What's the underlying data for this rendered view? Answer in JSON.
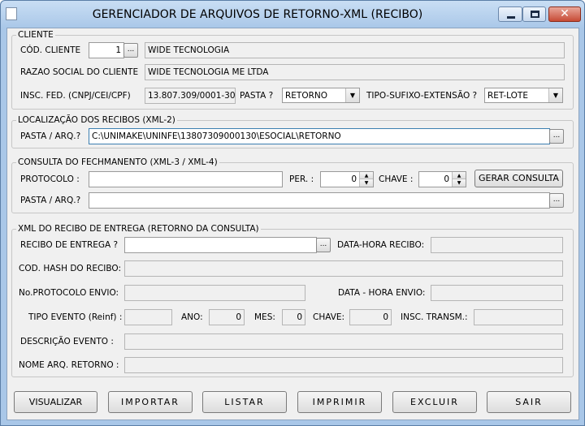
{
  "window": {
    "title": "GERENCIADOR DE ARQUIVOS DE RETORNO-XML (RECIBO)",
    "controls": [
      "minimize-icon",
      "maximize-icon",
      "close-icon"
    ],
    "close_glyph": "✕"
  },
  "cliente": {
    "group_title": "CLIENTE",
    "cod_label": "CÓD.  CLIENTE",
    "cod_value": "1",
    "cod_lookup": "...",
    "cod_name": "WIDE TECNOLOGIA",
    "razao_label": "RAZAO SOCIAL DO CLIENTE",
    "razao_value": "WIDE TECNOLOGIA ME LTDA",
    "insc_label": "INSC. FED.  (CNPJ/CEI/CPF)",
    "insc_value": "13.807.309/0001-30",
    "pasta_label": "PASTA ?",
    "pasta_value": "RETORNO",
    "tipo_label": "TIPO-SUFIXO-EXTENSÃO ?",
    "tipo_value": "RET-LOTE"
  },
  "localizacao": {
    "group_title": "LOCALIZAÇÃO DOS RECIBOS (XML-2)",
    "pasta_label": "PASTA / ARQ.?",
    "pasta_value": "C:\\UNIMAKE\\UNINFE\\13807309000130\\ESOCIAL\\RETORNO",
    "lookup": "..."
  },
  "consulta": {
    "group_title": "CONSULTA DO FECHMANENTO (XML-3 / XML-4)",
    "protocolo_label": "PROTOCOLO  :",
    "protocolo_value": "",
    "per_label": "PER. :",
    "per_value": "0",
    "chave_label": "CHAVE :",
    "chave_value": "0",
    "gerar_button": "GERAR CONSULTA",
    "pasta_label": "PASTA / ARQ.?",
    "pasta_value": "",
    "lookup": "..."
  },
  "recibo": {
    "group_title": "XML DO RECIBO DE ENTREGA (RETORNO DA CONSULTA)",
    "recibo_label": "RECIBO DE ENTREGA ?",
    "recibo_value": "",
    "recibo_lookup": "...",
    "datahora_recibo_label": "DATA-HORA RECIBO:",
    "datahora_recibo_value": "",
    "hash_label": "COD. HASH DO RECIBO:",
    "hash_value": "",
    "protocolo_envio_label": "No.PROTOCOLO ENVIO:",
    "protocolo_envio_value": "",
    "datahora_envio_label": "DATA - HORA ENVIO:",
    "datahora_envio_value": "",
    "tipo_evento_label": "TIPO EVENTO (Reinf) :",
    "tipo_evento_value": "",
    "ano_label": "ANO:",
    "ano_value": "0",
    "mes_label": "MES:",
    "mes_value": "0",
    "chave_label": "CHAVE:",
    "chave_value": "0",
    "insc_transm_label": "INSC. TRANSM.:",
    "insc_transm_value": "",
    "descricao_label": "DESCRIÇÃO  EVENTO   :",
    "descricao_value": "",
    "nome_arq_label": "NOME ARQ. RETORNO :",
    "nome_arq_value": ""
  },
  "buttons": {
    "visualizar": "VISUALIZAR",
    "importar": "IMPORTAR",
    "listar": "LISTAR",
    "imprimir": "IMPRIMIR",
    "excluir": "EXCLUIR",
    "sair": "SAIR"
  },
  "icons": {
    "dropdown": "▼",
    "spin_up": "▲",
    "spin_down": "▼"
  }
}
